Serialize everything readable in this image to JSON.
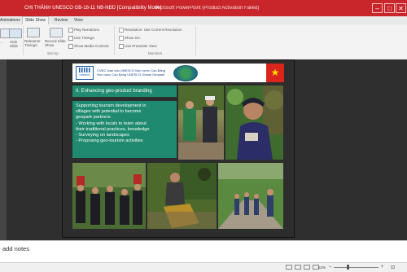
{
  "window": {
    "title": "CHỊ THẢNH UNESCO GB-18-11 NB-NĐD [Compatibility Mode]",
    "app_suffix": "Microsoft PowerPoint (Product Activation Failed)",
    "minimize_label": "–",
    "maximize_label": "□",
    "close_label": "✕"
  },
  "ribbon": {
    "tabs": [
      "Animations",
      "Slide Show",
      "Review",
      "View"
    ],
    "active_tab": "Slide Show",
    "buttons": {
      "from_label": "...",
      "hide_slide_label": "Hide Slide",
      "rehearse_label": "Rehearse Timings",
      "record_label": "Record Slide Show"
    },
    "checkboxes": [
      "Play Narrations",
      "Use Timings",
      "Show Media Controls"
    ],
    "monitors": {
      "resolution": "Resolution: Use Current Resolution",
      "show_on": "Show On:",
      "presenter_view": "Use Presenter View"
    },
    "group_labels": {
      "setup": "Set Up",
      "monitors": "Monitors"
    },
    "colors": {
      "title_bar": "#c8262b"
    }
  },
  "slide": {
    "header_line1": "CVĐC toàn cầu UNESCO  Non nước Cao Bằng",
    "header_line2": "Non nuoc Cao Bang UNESCO Global Geopark",
    "logo_text": "unesco",
    "heading": "II. Enhancing geo-product branding",
    "body_lines": [
      "Supporting tourism development in",
      "villages with potential to become",
      "geopark partners:",
      "-  Working with locals to learn about",
      "   their traditional practices, knowledge",
      "-  Surveying on landscapes",
      "-  Proposing geo-tourism activities"
    ],
    "colors": {
      "heading_bg": "#1f8a6f",
      "flag": "#da251d"
    }
  },
  "notes": {
    "placeholder": "Click to add notes",
    "visible_text": "add notes"
  },
  "status": {
    "zoom": "62%",
    "zoom_level": 0.62,
    "fit_label": "⊡"
  }
}
